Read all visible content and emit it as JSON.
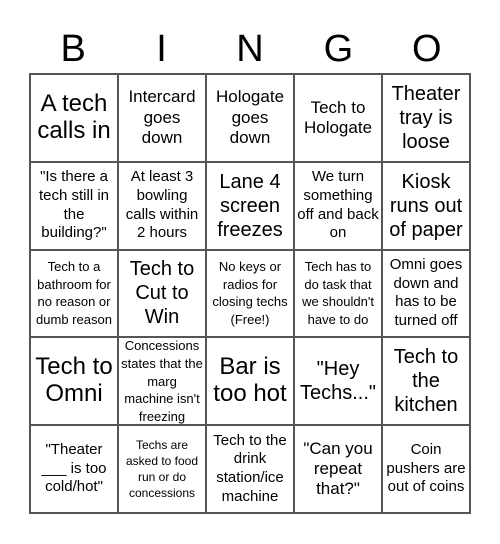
{
  "header": {
    "letters": [
      "B",
      "I",
      "N",
      "G",
      "O"
    ]
  },
  "cells": [
    [
      "A tech calls in",
      "Intercard goes down",
      "Hologate goes down",
      "Tech to Hologate",
      "Theater tray is loose"
    ],
    [
      "\"Is there a tech still in the building?\"",
      "At least 3 bowling calls within 2 hours",
      "Lane 4 screen freezes",
      "We turn something off and back on",
      "Kiosk runs out of paper"
    ],
    [
      "Tech to a bathroom for no reason or dumb reason",
      "Tech to Cut to Win",
      "No keys or radios for closing techs (Free!)",
      "Tech has to do task that we shouldn't have to do",
      "Omni goes down and has to be turned off"
    ],
    [
      "Tech to Omni",
      "Concessions states that the marg machine isn't freezing",
      "Bar is too hot",
      "\"Hey Techs...\"",
      "Tech to the kitchen"
    ],
    [
      "\"Theater ___ is too cold/hot\"",
      "Techs are asked to food run or do concessions",
      "Tech to the drink station/ice machine",
      "\"Can you repeat that?\"",
      "Coin pushers are out of coins"
    ]
  ]
}
